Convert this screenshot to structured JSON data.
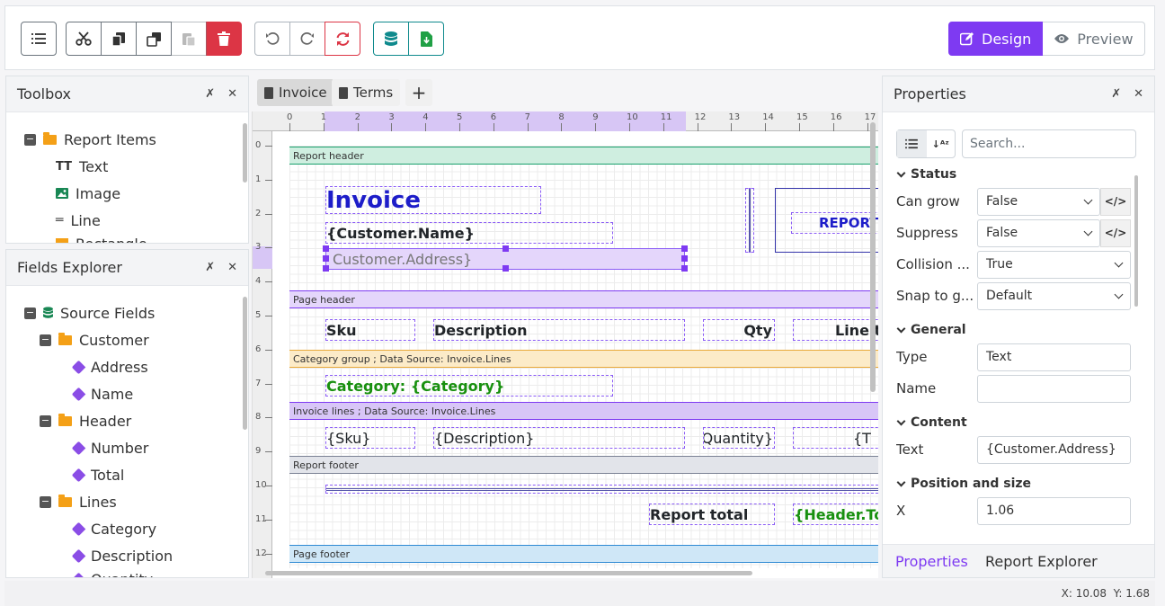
{
  "toolbar": {
    "groups": [
      {
        "buttons": [
          "list-icon"
        ]
      },
      {
        "buttons": [
          "cut-icon",
          "copy-icon",
          "duplicate-icon",
          "paste-icon",
          "delete-icon"
        ]
      },
      {
        "buttons": [
          "undo-icon",
          "redo-icon",
          "refresh-icon"
        ]
      },
      {
        "buttons": [
          "database-icon",
          "export-icon"
        ]
      }
    ],
    "design_label": "Design",
    "preview_label": "Preview",
    "accent": "#7e3af2"
  },
  "toolbox": {
    "title": "Toolbox",
    "root": "Report Items",
    "items": [
      "Text",
      "Image",
      "Line",
      "Rectangle"
    ]
  },
  "fields": {
    "title": "Fields Explorer",
    "root": "Source Fields",
    "customer": {
      "label": "Customer",
      "children": [
        "Address",
        "Name"
      ]
    },
    "header": {
      "label": "Header",
      "children": [
        "Number",
        "Total"
      ]
    },
    "lines": {
      "label": "Lines",
      "children": [
        "Category",
        "Description",
        "Quantity"
      ]
    }
  },
  "tabs": {
    "invoice": "Invoice",
    "terms": "Terms",
    "add": "+"
  },
  "ruler": {
    "h": [
      "0",
      "1",
      "2",
      "3",
      "4",
      "5",
      "6",
      "7",
      "8",
      "9",
      "10",
      "11",
      "12",
      "13",
      "14",
      "15",
      "16",
      "17"
    ],
    "v": [
      "0",
      "1",
      "2",
      "3",
      "4",
      "5",
      "6",
      "7",
      "8",
      "9",
      "10",
      "11",
      "12"
    ]
  },
  "report": {
    "bands": {
      "report_header": "Report header",
      "page_header": "Page header",
      "category_group": "Category group ; Data Source: Invoice.Lines",
      "invoice_lines": "Invoice lines ; Data Source: Invoice.Lines",
      "report_footer": "Report footer",
      "page_footer": "Page footer"
    },
    "invoice_title": "Invoice",
    "customer_name": "{Customer.Name}",
    "customer_address": "Customer.Address}",
    "report_stamp": "REPORT",
    "col_sku": "Sku",
    "col_description": "Description",
    "col_qty": "Qty",
    "col_line": "Line t",
    "category": "Category: {Category}",
    "row_sku": "{Sku}",
    "row_description": "{Description}",
    "row_quantity": "{Quantity}",
    "row_total": "{T",
    "report_total": "Report total",
    "header_total": "{Header.To"
  },
  "properties": {
    "title": "Properties",
    "search_placeholder": "Search...",
    "status": {
      "label": "Status",
      "can_grow_label": "Can grow",
      "can_grow": "False",
      "suppress_label": "Suppress",
      "suppress": "False",
      "collision_label": "Collision ...",
      "collision": "True",
      "snap_label": "Snap to g...",
      "snap": "Default"
    },
    "general": {
      "label": "General",
      "type_label": "Type",
      "type": "Text",
      "name_label": "Name",
      "name": ""
    },
    "content": {
      "label": "Content",
      "text_label": "Text",
      "text": "{Customer.Address}"
    },
    "position": {
      "label": "Position and size",
      "x_label": "X",
      "x": "1.06"
    },
    "bottom_tabs": {
      "properties": "Properties",
      "report_explorer": "Report Explorer"
    }
  },
  "status_bar": {
    "coords": "X: 10.08  Y: 1.68"
  }
}
